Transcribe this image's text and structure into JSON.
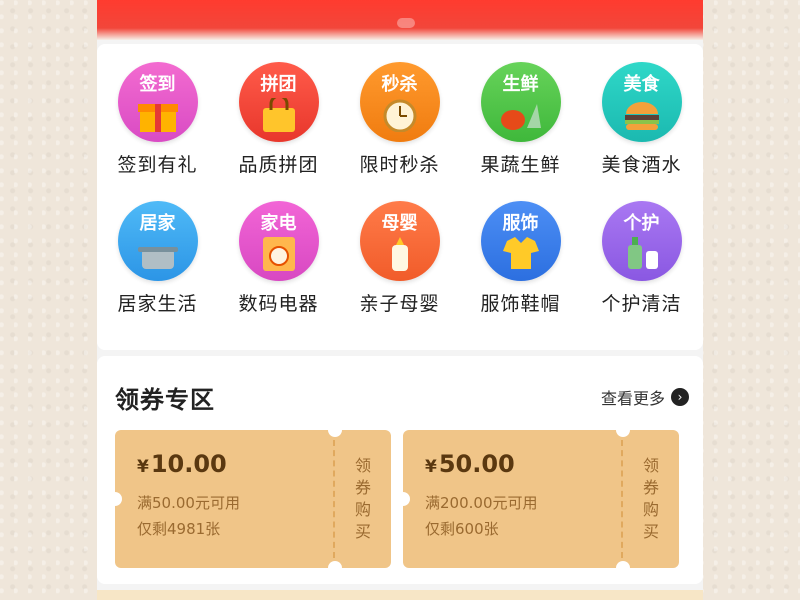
{
  "categories": [
    {
      "badge": "签到",
      "label": "签到有礼",
      "color_top": "#f36bd0",
      "color_bottom": "#d94bc4",
      "icon": "gift-icon"
    },
    {
      "badge": "拼团",
      "label": "品质拼团",
      "color_top": "#ff5b4a",
      "color_bottom": "#e8372c",
      "icon": "shopping-bag-icon"
    },
    {
      "badge": "秒杀",
      "label": "限时秒杀",
      "color_top": "#ff9a2e",
      "color_bottom": "#f07c10",
      "icon": "alarm-clock-icon"
    },
    {
      "badge": "生鲜",
      "label": "果蔬生鲜",
      "color_top": "#67d35a",
      "color_bottom": "#3fb83b",
      "icon": "vegetables-icon"
    },
    {
      "badge": "美食",
      "label": "美食酒水",
      "color_top": "#2fd8c8",
      "color_bottom": "#1bb9b0",
      "icon": "burger-icon"
    },
    {
      "badge": "居家",
      "label": "居家生活",
      "color_top": "#4fbaf7",
      "color_bottom": "#2c95e6",
      "icon": "pot-icon"
    },
    {
      "badge": "家电",
      "label": "数码电器",
      "color_top": "#f265d6",
      "color_bottom": "#d848c2",
      "icon": "washing-machine-icon"
    },
    {
      "badge": "母婴",
      "label": "亲子母婴",
      "color_top": "#ff7b49",
      "color_bottom": "#f15c2a",
      "icon": "baby-bottle-icon"
    },
    {
      "badge": "服饰",
      "label": "服饰鞋帽",
      "color_top": "#4d8ff5",
      "color_bottom": "#2c6fe0",
      "icon": "shirt-icon"
    },
    {
      "badge": "个护",
      "label": "个护清洁",
      "color_top": "#a978f2",
      "color_bottom": "#8a58e2",
      "icon": "lotion-bottle-icon"
    }
  ],
  "coupon_section": {
    "title": "领券专区",
    "more_label": "查看更多",
    "coupons": [
      {
        "currency": "¥",
        "amount": "10.00",
        "condition": "满50.00元可用",
        "remaining": "仅剩4981张",
        "claim": [
          "领",
          "券",
          "购",
          "买"
        ]
      },
      {
        "currency": "¥",
        "amount": "50.00",
        "condition": "满200.00元可用",
        "remaining": "仅剩600张",
        "claim": [
          "领",
          "券",
          "购",
          "买"
        ]
      }
    ]
  },
  "colors": {
    "banner": "#ff3b2f",
    "coupon_bg": "#f0c588",
    "coupon_text": "#9a6a30"
  }
}
